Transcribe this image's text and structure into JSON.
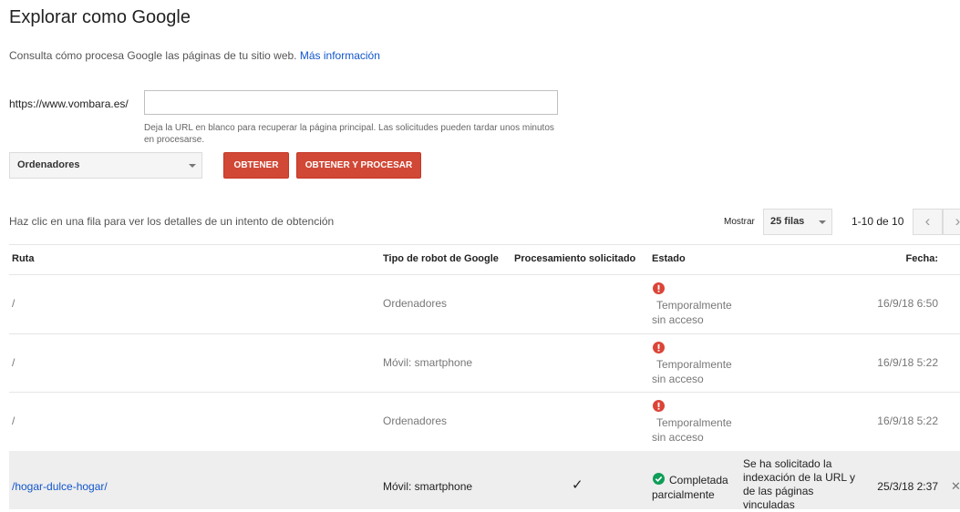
{
  "header": {
    "title": "Explorar como Google",
    "subtitle": "Consulta cómo procesa Google las páginas de tu sitio web.",
    "more_info_link": "Más información"
  },
  "fetch_form": {
    "url_prefix": "https://www.vombara.es/",
    "url_value": "",
    "help_text": "Deja la URL en blanco para recuperar la página principal. Las solicitudes pueden tardar unos minutos en procesarse.",
    "device_selected": "Ordenadores",
    "fetch_button": "OBTENER",
    "fetch_render_button": "OBTENER Y PROCESAR"
  },
  "table_controls": {
    "hint": "Haz clic en una fila para ver los detalles de un intento de obtención",
    "show_label": "Mostrar",
    "rows_selected": "25 filas",
    "range": "1-10 de 10"
  },
  "table": {
    "columns": [
      "Ruta",
      "Tipo de robot de Google",
      "Procesamiento solicitado",
      "Estado",
      "Fecha:"
    ],
    "rows": [
      {
        "path": "/",
        "bot": "Ordenadores",
        "status_line1": "Temporalmente",
        "status_line2": "sin acceso",
        "date": "16/9/18 6:50"
      },
      {
        "path": "/",
        "bot": "Móvil: smartphone",
        "status_line1": "Temporalmente",
        "status_line2": "sin acceso",
        "date": "16/9/18 5:22"
      },
      {
        "path": "/",
        "bot": "Ordenadores",
        "status_line1": "Temporalmente",
        "status_line2": "sin acceso",
        "date": "16/9/18 5:22"
      },
      {
        "path": "/hogar-dulce-hogar/",
        "bot": "Móvil: smartphone",
        "render": "✓",
        "status_line1": "Completada",
        "status_line2": "parcialmente",
        "note": "Se ha solicitado la indexación de la URL y de las páginas vinculadas",
        "date": "25/3/18 2:37"
      }
    ]
  },
  "colors": {
    "primary_button": "#d14836",
    "link": "#1155cc",
    "error": "#db4437",
    "success": "#0f9d58"
  },
  "icons": {
    "error": "error-circle-icon",
    "success": "check-circle-icon",
    "render": "check-icon",
    "dismiss": "close-icon",
    "prev": "chevron-left-icon",
    "next": "chevron-right-icon"
  }
}
